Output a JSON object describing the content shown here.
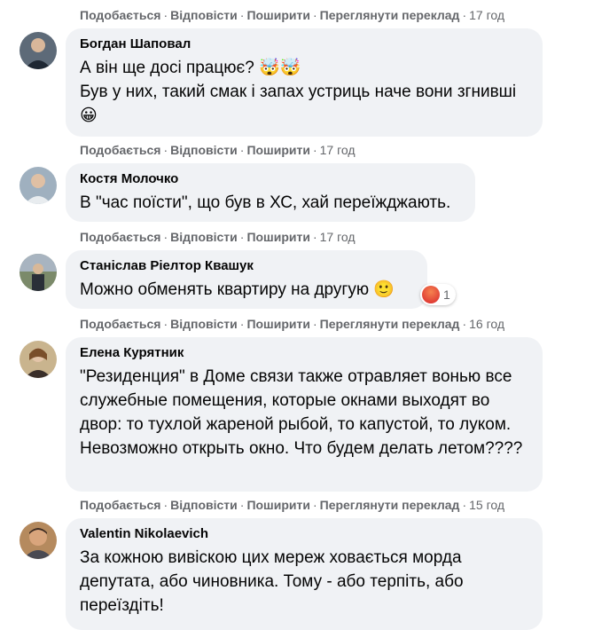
{
  "actions": {
    "like": "Подобається",
    "reply": "Відповісти",
    "share": "Поширити",
    "translate": "Переглянути переклад",
    "separator": "·"
  },
  "top_action_bar": {
    "time": "17 год"
  },
  "comments": [
    {
      "author": "Богдан Шаповал",
      "text": "А він ще досі працює? 🤯🤯\nБув у них, такий смак і запах устриць наче вони згнивші😀",
      "time": "17 год",
      "avatar_color": "#6d7a88"
    },
    {
      "author": "Костя Молочко",
      "text": "В \"час поїсти\", що був в ХС, хай переїжджають.",
      "time": "17 год",
      "avatar_color": "#8a9aa8"
    },
    {
      "author": "Станіслав Ріелтор Квашук",
      "text": "Можно обменять квартиру на другую 🙂",
      "time": "16 год",
      "reaction_count": "1",
      "avatar_color": "#7c8a70"
    },
    {
      "author": "Елена Курятник",
      "text": "\"Резиденция\" в Доме связи также отравляет вонью все служебные помещения, которые окнами выходят во двор: то тухлой жареной рыбой, то капустой, то луком. Невозможно открыть окно. Что будем делать летом????",
      "time": "15 год",
      "avatar_color": "#a08060"
    },
    {
      "author": "Valentin Nikolaevich",
      "text": "За кожною вивіскою цих мереж ховається морда депутата, або чиновника. Тому - або терпіть, або переїздіть!",
      "avatar_color": "#b48a62"
    }
  ]
}
